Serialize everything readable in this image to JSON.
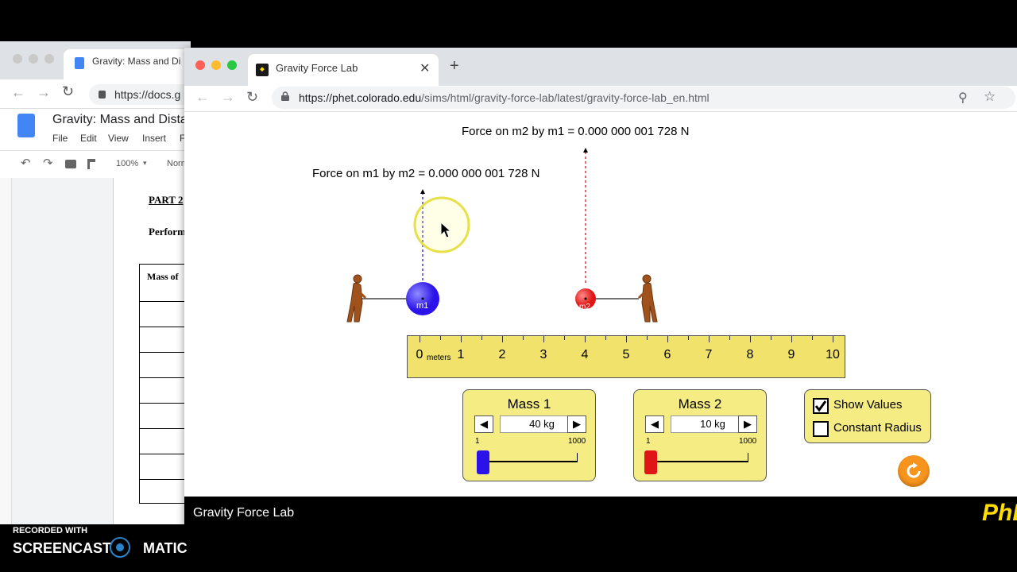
{
  "docs_window": {
    "tab_title": "Gravity: Mass and Di",
    "url": "https://docs.g",
    "doc_title": "Gravity: Mass and Dista",
    "menu": [
      "File",
      "Edit",
      "View",
      "Insert",
      "F"
    ],
    "zoom": "100%",
    "style": "Norm",
    "heading": "PART 2",
    "perform_text": "Perform",
    "table_header": "Mass of"
  },
  "browser": {
    "tab_title": "Gravity Force Lab",
    "url_host": "https://phet.colorado.edu",
    "url_path": "/sims/html/gravity-force-lab/latest/gravity-force-lab_en.html"
  },
  "sim": {
    "force_m2_label": "Force on m2 by m1 = 0.000 000 001 728 N",
    "force_m1_label": "Force on m1 by m2 = 0.000 000 001 728 N",
    "m1_label": "m1",
    "m2_label": "m2",
    "ruler": {
      "ticks": [
        "0",
        "1",
        "2",
        "3",
        "4",
        "5",
        "6",
        "7",
        "8",
        "9",
        "10"
      ],
      "units": "meters"
    },
    "mass1": {
      "title": "Mass 1",
      "value": "40 kg",
      "min": "1",
      "max": "1000",
      "level": 0.04,
      "color": "#2a12e8"
    },
    "mass2": {
      "title": "Mass 2",
      "value": "10 kg",
      "min": "1",
      "max": "1000",
      "level": 0.01,
      "color": "#e01515"
    },
    "options": {
      "show_values": "Show Values",
      "show_values_checked": true,
      "constant_radius": "Constant Radius",
      "constant_radius_checked": false
    }
  },
  "navbar": {
    "title": "Gravity Force Lab",
    "logo": "PhET"
  },
  "watermark": {
    "top": "RECORDED WITH",
    "left": "SCREENCAST",
    "right": "MATIC"
  }
}
